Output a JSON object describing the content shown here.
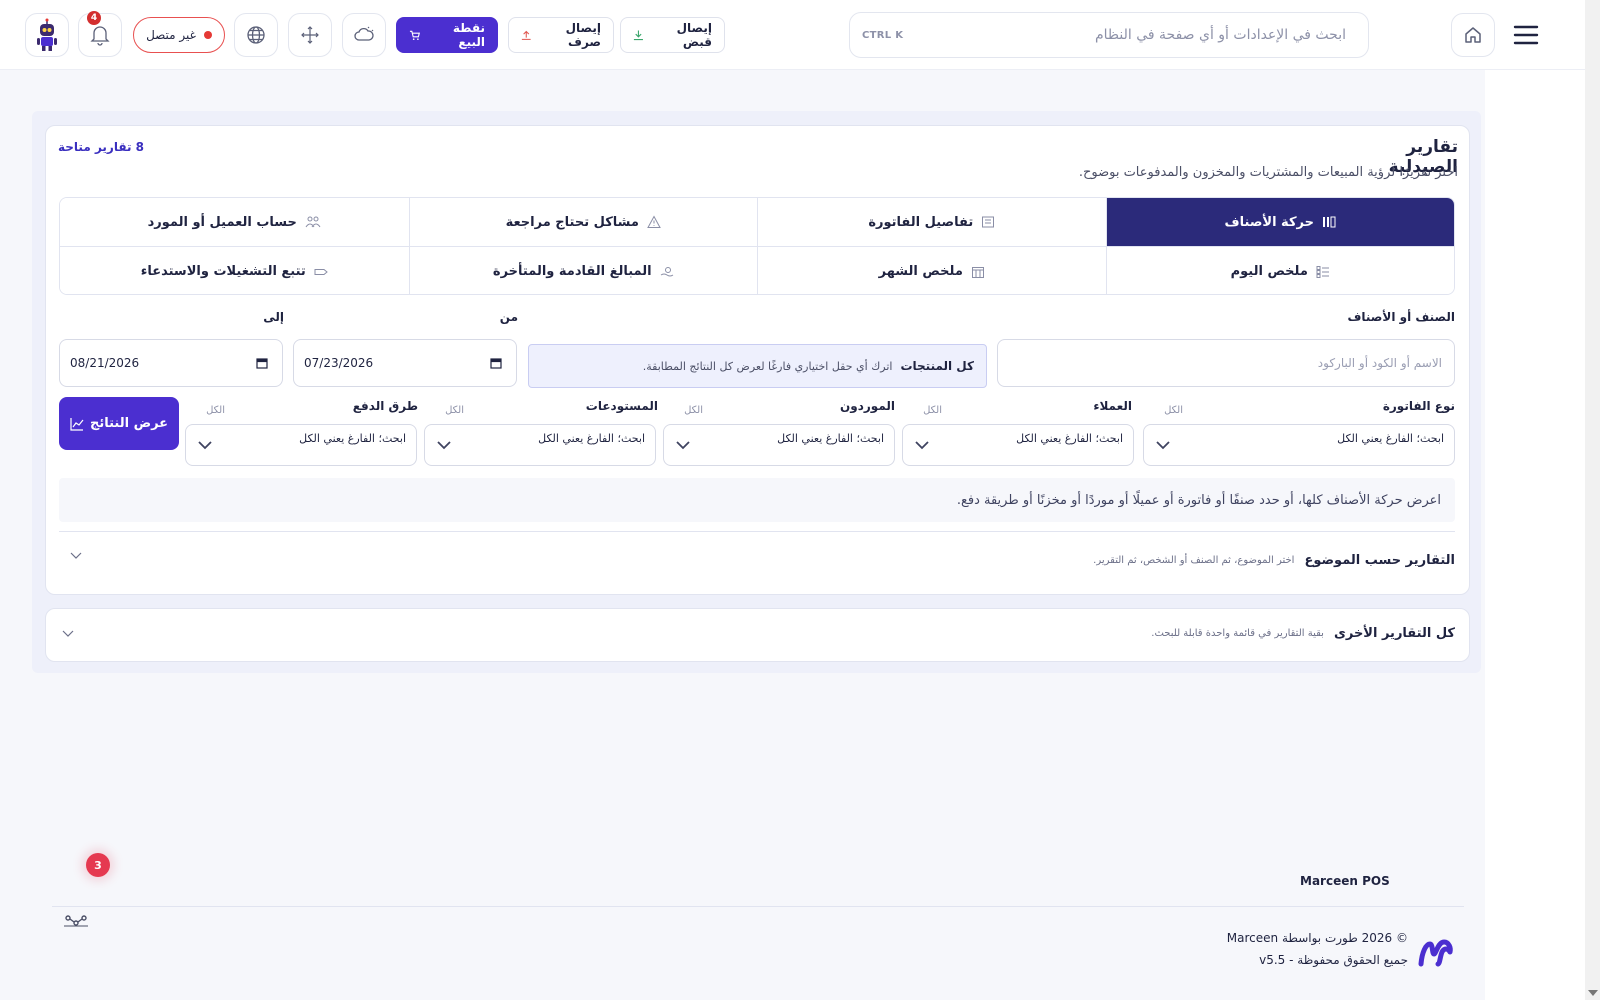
{
  "topbar": {
    "search_placeholder": "ابحث في الإعدادات أو أي صفحة في النظام",
    "search_shortcut": "CTRL K",
    "receipt_in_label": "إيصال قبض",
    "receipt_out_label": "إيصال صرف",
    "pos_label": "نقطة البيع",
    "status_label": "غير متصل",
    "notifications_count": "4",
    "accent_color": "#4b2fd0",
    "status_color": "#e53935"
  },
  "page": {
    "title": "تقارير الصيدلية",
    "subtitle": "اختر تقريرًا لرؤية المبيعات والمشتريات والمخزون والمدفوعات بوضوح.",
    "count_label": "8 تقارير متاحة"
  },
  "tabs": [
    {
      "label": "حركة الأصناف",
      "icon": "bars-icon",
      "active": true
    },
    {
      "label": "تفاصيل الفاتورة",
      "icon": "invoice-icon",
      "active": false
    },
    {
      "label": "مشاكل تحتاج مراجعة",
      "icon": "warning-icon",
      "active": false
    },
    {
      "label": "حساب العميل أو المورد",
      "icon": "people-icon",
      "active": false
    },
    {
      "label": "ملخص اليوم",
      "icon": "list-icon",
      "active": false
    },
    {
      "label": "ملخص الشهر",
      "icon": "calendar-icon",
      "active": false
    },
    {
      "label": "المبالغ القادمة والمتأخرة",
      "icon": "money-icon",
      "active": false
    },
    {
      "label": "تتبع التشغيلات والاستدعاء",
      "icon": "tag-icon",
      "active": false
    }
  ],
  "filters": {
    "item_label": "الصنف أو الأصناف",
    "item_placeholder": "الاسم أو الكود أو الباركود",
    "all_products_label": "كل المنتجات",
    "all_products_hint": "اترك أي حقل اختياري فارغًا لعرض كل النتائج المطابقة.",
    "from_label": "من",
    "to_label": "إلى",
    "from_date": "07/23/2026",
    "to_date": "08/21/2026",
    "selects": [
      {
        "label": "نوع الفاتورة",
        "hint": "الكل",
        "value": "ابحث؛ الفارغ يعني الكل"
      },
      {
        "label": "العملاء",
        "hint": "الكل",
        "value": "ابحث؛ الفارغ يعني الكل"
      },
      {
        "label": "الموردون",
        "hint": "الكل",
        "value": "ابحث؛ الفارغ يعني الكل"
      },
      {
        "label": "المستودعات",
        "hint": "الكل",
        "value": "ابحث؛ الفارغ يعني الكل"
      },
      {
        "label": "طرق الدفع",
        "hint": "الكل",
        "value": "ابحث؛ الفارغ يعني الكل"
      }
    ],
    "show_button": "عرض النتائج",
    "info_text": "اعرض حركة الأصناف كلها، أو حدد صنفًا أو فاتورة أو عميلًا أو موردًا أو مخزنًا أو طريقة دفع."
  },
  "sections": {
    "by_topic_title": "التقارير حسب الموضوع",
    "by_topic_desc": "اختر الموضوع، ثم الصنف أو الشخص، ثم التقرير.",
    "other_title": "كل التقارير الأخرى",
    "other_desc": "بقية التقارير في قائمة واحدة قابلة للبحث."
  },
  "footer": {
    "brand": "Marceen POS",
    "copyright": "© 2026 طورت بواسطة Marceen",
    "rights": "جميع الحقوق محفوظة - v5.5",
    "floating_badge": "3"
  }
}
